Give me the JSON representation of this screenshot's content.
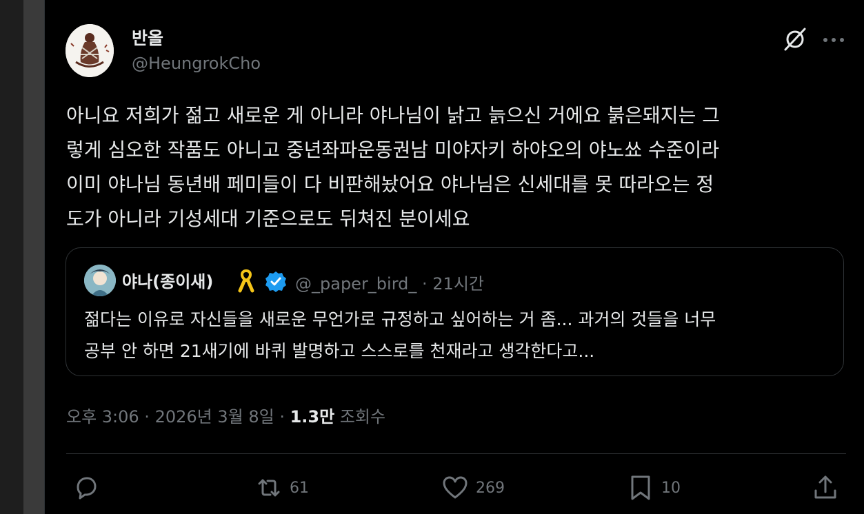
{
  "author": {
    "display_name": "반올",
    "handle": "@HeungrokCho"
  },
  "tweet": {
    "lines": [
      "아니요 저희가 젊고 새로운 게 아니라 야나님이 낡고 늙으신 거에요 붉은돼지는 그",
      "렇게 심오한 작품도 아니고 중년좌파운동권남 미야자키 하야오의 야노쑈 수준이라",
      "이미 야나님 동년배 페미들이 다 비판해놨어요 야나님은 신세대를 못 따라오는 정",
      "도가 아니라 기성세대 기준으로도 뒤쳐진 분이세요"
    ]
  },
  "quote": {
    "display_name": "야나(종이새)",
    "handle": "@_paper_bird_",
    "time": " · 21시간",
    "lines": [
      "젊다는 이유로 자신들을 새로운 무언가로 규정하고 싶어하는 거 좀... 과거의 것들을 너무",
      "공부 안 하면 21새기에 바퀴 발명하고 스스로를 천재라고 생각한다고..."
    ]
  },
  "meta": {
    "time": "오후 3:06 · 2026년 3월 8일 · ",
    "views_count": "1.3만",
    "views_label": " 조회수"
  },
  "actions": {
    "reposts": "61",
    "likes": "269",
    "bookmarks": "10"
  },
  "icons": {
    "grok": "grok-icon",
    "more": "more-icon",
    "reply": "reply-icon",
    "repost": "repost-icon",
    "like": "heart-icon",
    "bookmark": "bookmark-icon",
    "share": "share-icon",
    "verified": "verified-badge-icon",
    "ribbon": "yellow-ribbon-icon"
  },
  "colors": {
    "background": "#000000",
    "text": "#e7e9ea",
    "secondary": "#71767b",
    "verified": "#1d9bf0",
    "border": "#2f3336"
  }
}
